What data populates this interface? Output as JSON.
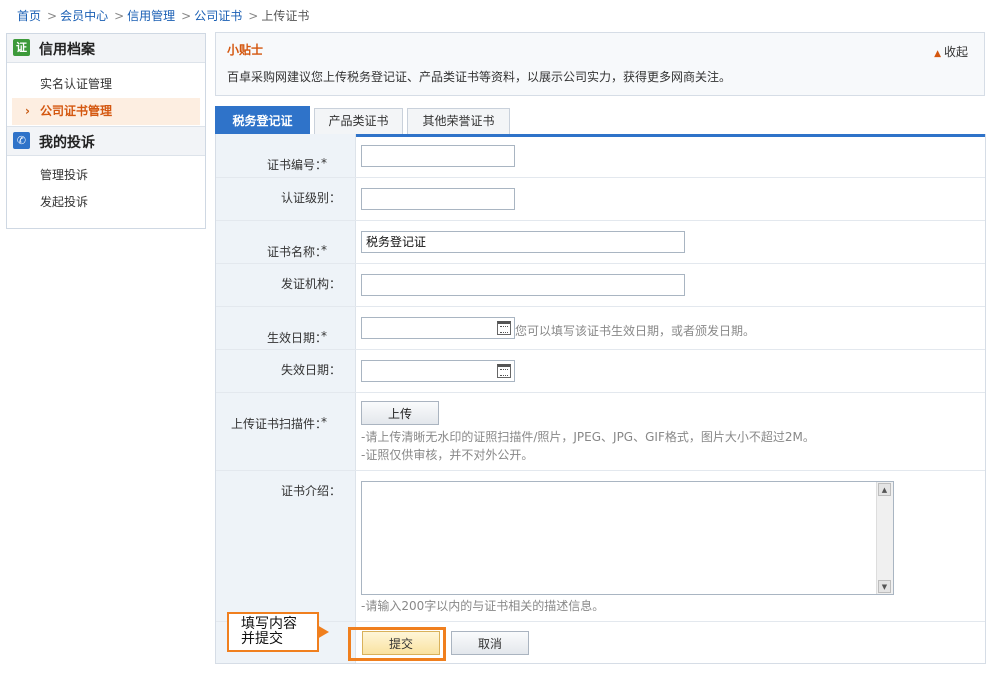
{
  "breadcrumb": {
    "items": [
      "首页",
      "会员中心",
      "信用管理",
      "公司证书"
    ],
    "current": "上传证书",
    "separator": ">"
  },
  "sidebar": {
    "section1": {
      "icon_char": "证",
      "title": "信用档案",
      "items": [
        "实名认证管理",
        "公司证书管理"
      ],
      "active_index": 1
    },
    "section2": {
      "icon_char": "📞",
      "title": "我的投诉",
      "items": [
        "管理投诉",
        "发起投诉"
      ]
    }
  },
  "tips": {
    "title": "小贴士",
    "text": "百卓采购网建议您上传税务登记证、产品类证书等资料，以展示公司实力，获得更多网商关注。",
    "collapse_label": "收起"
  },
  "tabs": [
    "税务登记证",
    "产品类证书",
    "其他荣誉证书"
  ],
  "active_tab": 0,
  "form": {
    "cert_no_label": "证书编号：",
    "level_label": "认证级别：",
    "name_label": "证书名称：",
    "name_value": "税务登记证",
    "issuer_label": "发证机构：",
    "effective_label": "生效日期：",
    "effective_hint": "您可以填写该证书生效日期，或者颁发日期。",
    "expire_label": "失效日期：",
    "upload_label": "上传证书扫描件：",
    "upload_button": "上传",
    "upload_hint1": "-请上传清晰无水印的证照扫描件/照片，JPEG、JPG、GIF格式，图片大小不超过2M。",
    "upload_hint2": "-证照仅供审核，并不对外公开。",
    "intro_label": "证书介绍：",
    "intro_hint": "-请输入200字以内的与证书相关的描述信息。",
    "required_mark": "*",
    "submit_label": "提交",
    "cancel_label": "取消"
  },
  "callout": {
    "line1": "填写内容",
    "line2": "并提交"
  },
  "colors": {
    "accent": "#2f73c9",
    "highlight": "#f07f1e",
    "required": "#e22222"
  }
}
